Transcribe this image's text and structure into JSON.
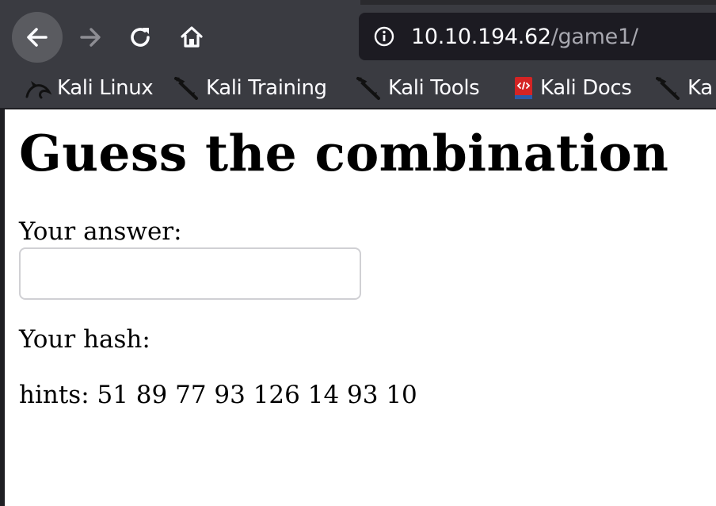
{
  "browser": {
    "url_host": "10.10.194.62",
    "url_path": "/game1/",
    "icons": {
      "back": "back-arrow-icon",
      "forward": "forward-arrow-icon",
      "reload": "reload-icon",
      "home": "home-icon",
      "site_info": "info-icon"
    },
    "colors": {
      "toolbar": "#3a3b41",
      "urlbar": "#1c1b22",
      "url_host": "#fbfbfe",
      "url_path": "#a8a8b0"
    }
  },
  "bookmarks": [
    {
      "label": "Kali Linux",
      "icon": "kali-dragon-icon"
    },
    {
      "label": "Kali Training",
      "icon": "kali-tool-icon"
    },
    {
      "label": "Kali Tools",
      "icon": "kali-tool-icon"
    },
    {
      "label": "Kali Docs",
      "icon": "docs-book-icon"
    },
    {
      "label": "Ka",
      "icon": "kali-tool-icon"
    }
  ],
  "page": {
    "title": "Guess the combination",
    "answer_label": "Your answer:",
    "answer_value": "",
    "hash_label": "Your hash:",
    "hints": "hints: 51 89 77 93 126 14 93 10"
  }
}
